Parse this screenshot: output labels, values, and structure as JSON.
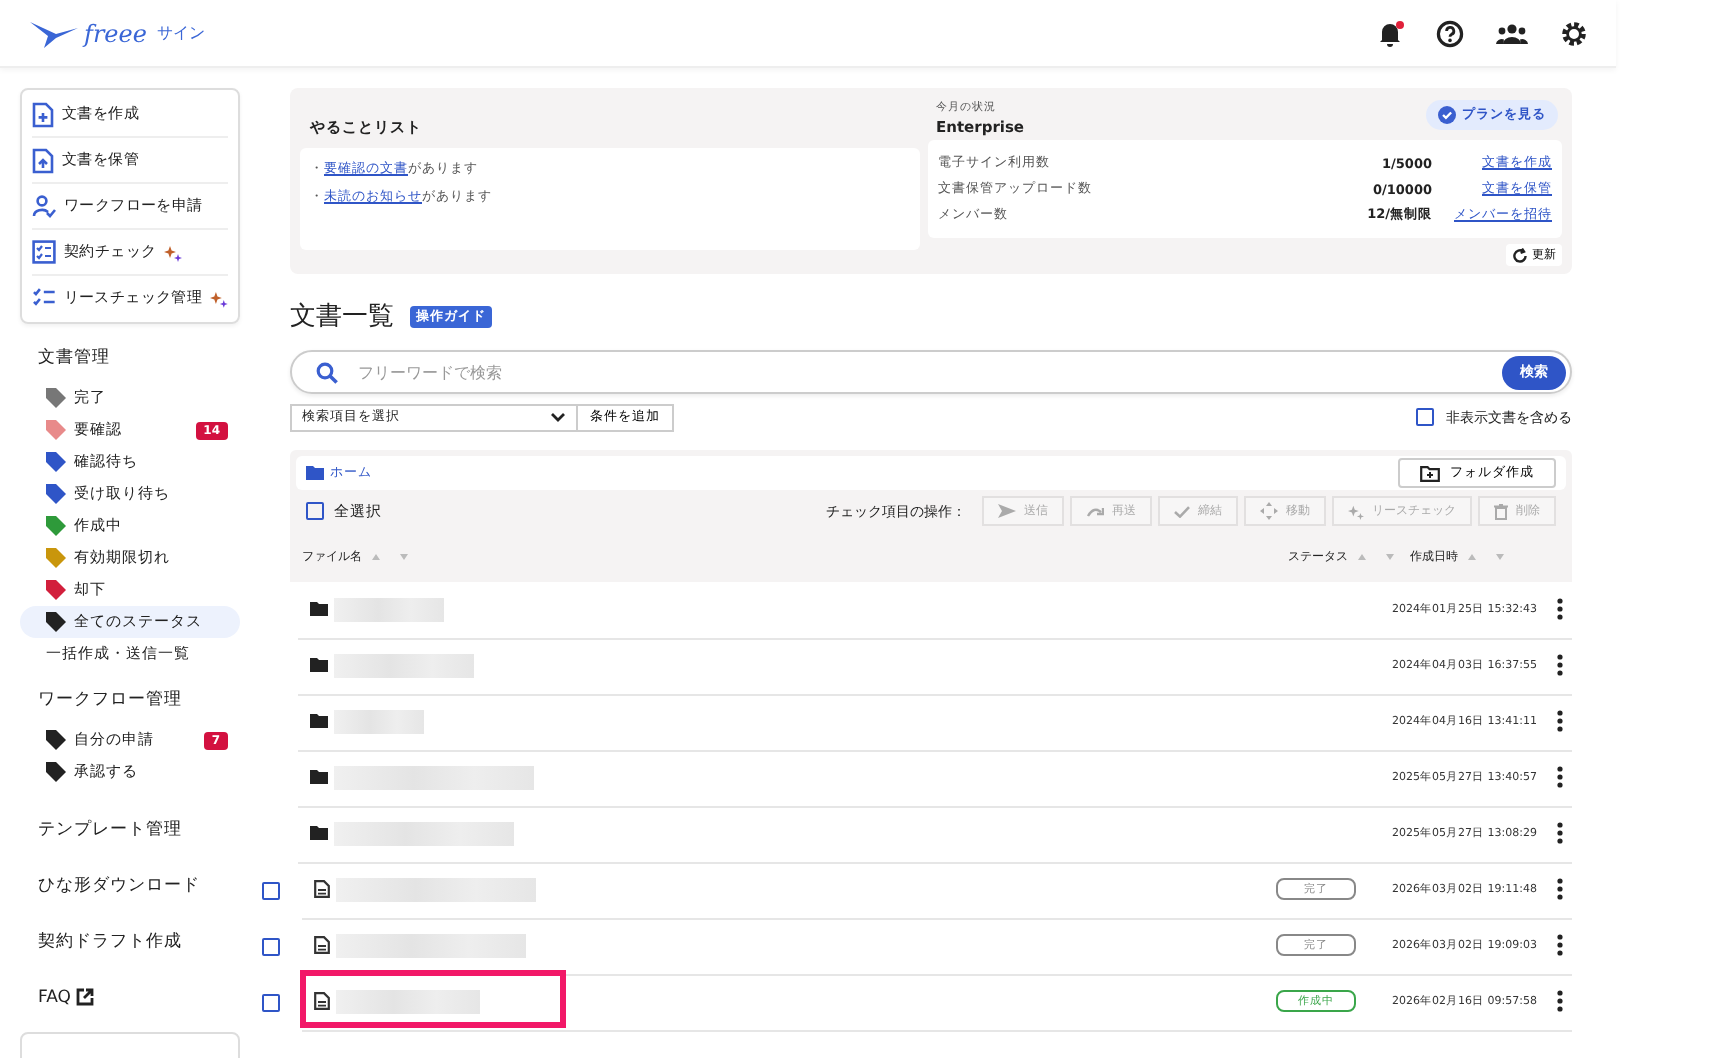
{
  "header": {
    "logo": "freee",
    "product": "サイン",
    "notification_unread": true
  },
  "sidebar": {
    "actions": [
      {
        "label": "文書を作成",
        "sparkle": false
      },
      {
        "label": "文書を保管",
        "sparkle": false
      },
      {
        "label": "ワークフローを申請",
        "sparkle": false
      },
      {
        "label": "契約チェック",
        "sparkle": true
      },
      {
        "label": "リースチェック管理",
        "sparkle": true
      }
    ],
    "doc_section": "文書管理",
    "statuses": [
      {
        "label": "完了",
        "color": "#777777",
        "selected": false
      },
      {
        "label": "要確認",
        "color": "#e88a8a",
        "badge": "14",
        "selected": false
      },
      {
        "label": "確認待ち",
        "color": "#2f55c7",
        "selected": false
      },
      {
        "label": "受け取り待ち",
        "color": "#2f55c7",
        "selected": false
      },
      {
        "label": "作成中",
        "color": "#2e9a3a",
        "selected": false
      },
      {
        "label": "有効期限切れ",
        "color": "#c9960c",
        "selected": false
      },
      {
        "label": "却下",
        "color": "#d21f3c",
        "selected": false
      },
      {
        "label": "全てのステータス",
        "color": "#222222",
        "selected": true
      }
    ],
    "bulk_link": "一括作成・送信一覧",
    "workflow_section": "ワークフロー管理",
    "workflow_items": [
      {
        "label": "自分の申請",
        "badge": "7"
      },
      {
        "label": "承認する"
      }
    ],
    "links": [
      "テンプレート管理",
      "ひな形ダウンロード",
      "契約ドラフト作成"
    ],
    "faq": "FAQ"
  },
  "todo": {
    "title": "やることリスト",
    "items": [
      {
        "bullet": "・",
        "link": "要確認の文書",
        "rest": "があります"
      },
      {
        "bullet": "・",
        "link": "未読のお知らせ",
        "rest": "があります"
      }
    ]
  },
  "usage": {
    "caption": "今月の状況",
    "plan": "Enterprise",
    "plan_button": "プランを見る",
    "rows": [
      {
        "label": "電子サイン利用数",
        "value": "1/5000",
        "action": "文書を作成"
      },
      {
        "label": "文書保管アップロード数",
        "value": "0/10000",
        "action": "文書を保管"
      },
      {
        "label": "メンバー数",
        "value": "12/無制限",
        "action": "メンバーを招待"
      }
    ],
    "refresh": "更新"
  },
  "documents": {
    "title": "文書一覧",
    "guide": "操作ガイド",
    "search_placeholder": "フリーワードで検索",
    "search_button": "検索",
    "filter_select": "検索項目を選択",
    "add_condition": "条件を追加",
    "include_hidden": {
      "label": "非表示文書を含める",
      "checked": false
    },
    "breadcrumb": "ホーム",
    "new_folder": "フォルダ作成",
    "select_all": {
      "label": "全選択",
      "checked": false
    },
    "bulk_label": "チェック項目の操作：",
    "bulk_actions": [
      {
        "label": "送信"
      },
      {
        "label": "再送"
      },
      {
        "label": "締結"
      },
      {
        "label": "移動"
      },
      {
        "label": "リースチェック"
      },
      {
        "label": "削除"
      }
    ],
    "columns": [
      "ファイル名",
      "ステータス",
      "作成日時"
    ],
    "rows": [
      {
        "kind": "folder",
        "date": "2024年01月25日 15:32:43",
        "highlighted": false
      },
      {
        "kind": "folder",
        "date": "2024年04月03日 16:37:55",
        "highlighted": false
      },
      {
        "kind": "folder",
        "date": "2024年04月16日 13:41:11",
        "highlighted": false
      },
      {
        "kind": "folder",
        "date": "2025年05月27日 13:40:57",
        "highlighted": false
      },
      {
        "kind": "folder",
        "date": "2025年05月27日 13:08:29",
        "highlighted": false
      },
      {
        "kind": "file",
        "checked": false,
        "status": {
          "label": "完了",
          "color": "#888888"
        },
        "date": "2026年03月02日 19:11:48",
        "highlighted": false
      },
      {
        "kind": "file",
        "checked": false,
        "status": {
          "label": "完了",
          "color": "#888888"
        },
        "date": "2026年03月02日 19:09:03",
        "highlighted": false
      },
      {
        "kind": "file",
        "checked": false,
        "status": {
          "label": "作成中",
          "color": "#3aa64a"
        },
        "date": "2026年02月16日 09:57:58",
        "highlighted": true
      }
    ]
  }
}
